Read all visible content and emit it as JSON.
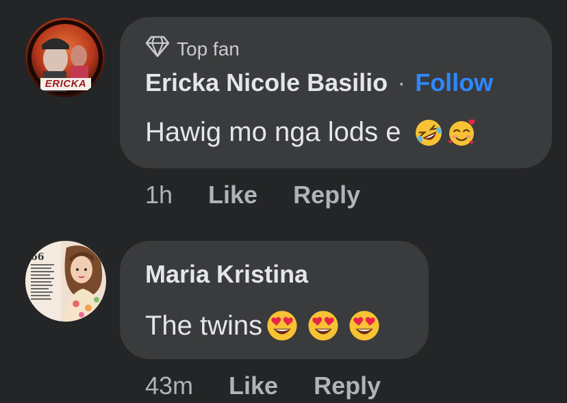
{
  "comments": [
    {
      "badge": {
        "icon": "diamond-icon",
        "label": "Top fan"
      },
      "author": "Ericka Nicole Basilio",
      "separator": "·",
      "follow_label": "Follow",
      "text": "Hawig mo nga lods e",
      "emojis": [
        "rolling-on-floor-laughing-emoji",
        "smiling-face-with-hearts-emoji"
      ],
      "avatar_text": "ERICKA",
      "time": "1h",
      "like_label": "Like",
      "reply_label": "Reply"
    },
    {
      "author": "Maria Kristina",
      "text": "The twins",
      "emojis": [
        "heart-eyes-emoji",
        "heart-eyes-emoji",
        "heart-eyes-emoji"
      ],
      "time": "43m",
      "like_label": "Like",
      "reply_label": "Reply"
    }
  ],
  "colors": {
    "background": "#242526",
    "bubble": "#3a3b3c",
    "link": "#2d88ff",
    "secondary_text": "#b0b3b8"
  }
}
